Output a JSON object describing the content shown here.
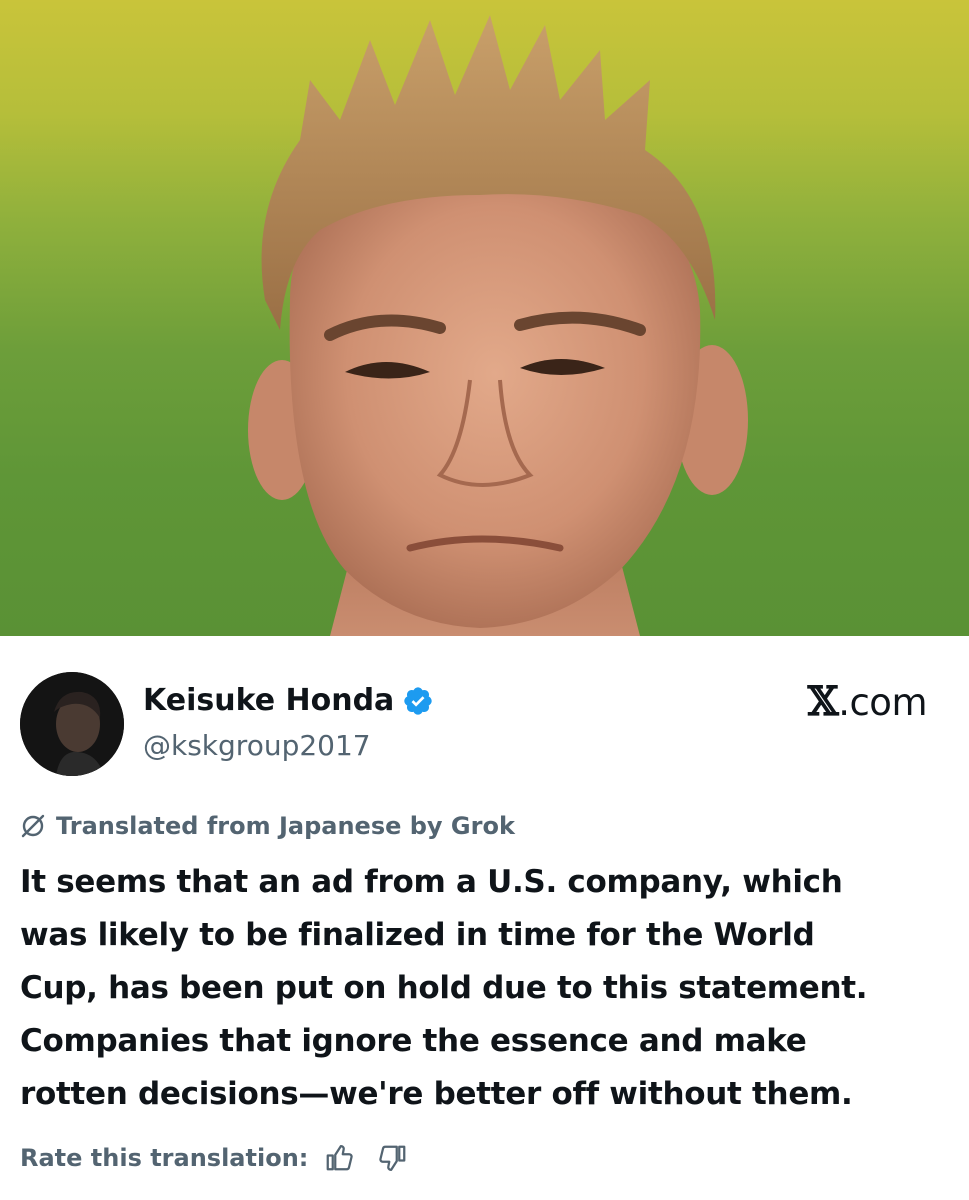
{
  "photo": {
    "icon": "photo-of-player"
  },
  "author": {
    "display_name": "Keisuke Honda",
    "handle": "@kskgroup2017",
    "verified_icon": "verified-badge-icon",
    "verified_color": "#1d9bf0"
  },
  "brand": {
    "mark": "𝕏",
    "suffix": ".com"
  },
  "translation": {
    "icon": "grok-icon",
    "label": "Translated from Japanese by Grok"
  },
  "tweet": {
    "text": "It seems that an ad from a U.S. company, which\nwas likely to be finalized in time for the World\nCup, has been put on hold due to this statement.\nCompanies that ignore the essence and make\nrotten decisions—we're better off without them."
  },
  "rating": {
    "label": "Rate this translation:",
    "thumbs_up_icon": "thumbs-up-icon",
    "thumbs_down_icon": "thumbs-down-icon"
  },
  "colors": {
    "text_primary": "#0f1419",
    "text_secondary": "#536471",
    "accent": "#1d9bf0"
  }
}
